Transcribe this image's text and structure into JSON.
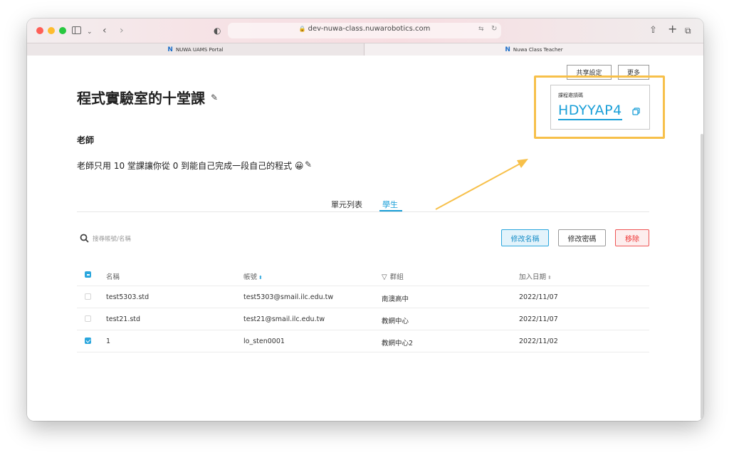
{
  "browser": {
    "url": "dev-nuwa-class.nuwarobotics.com",
    "tabs": [
      {
        "label": "NUWA UAMS Portal"
      },
      {
        "label": "Nuwa Class Teacher"
      }
    ]
  },
  "header": {
    "share_label": "共享設定",
    "more_label": "更多"
  },
  "course": {
    "title": "程式實驗室的十堂課",
    "teacher_label": "老師",
    "description": "老師只用 10 堂課讓你從 0 到能自己完成一段自己的程式 😀"
  },
  "invite": {
    "label": "課程邀請碼",
    "code": "HDYYAP4"
  },
  "tabs": {
    "units_label": "單元列表",
    "students_label": "學生"
  },
  "search": {
    "placeholder": "搜尋帳號/名稱"
  },
  "actions": {
    "rename_label": "修改名稱",
    "password_label": "修改密碼",
    "remove_label": "移除"
  },
  "table": {
    "columns": {
      "name": "名稱",
      "account": "帳號",
      "group": "群組",
      "date": "加入日期"
    },
    "rows": [
      {
        "name": "test5303.std",
        "account": "test5303@smail.ilc.edu.tw",
        "group": "南澳高中",
        "date": "2022/11/07",
        "checked": false
      },
      {
        "name": "test21.std",
        "account": "test21@smail.ilc.edu.tw",
        "group": "教網中心",
        "date": "2022/11/07",
        "checked": false
      },
      {
        "name": "1",
        "account": "lo_sten0001",
        "group": "教網中心2",
        "date": "2022/11/02",
        "checked": true
      }
    ]
  },
  "colors": {
    "accent": "#1a9fd8",
    "highlight": "#f7c04a",
    "danger": "#e33333"
  }
}
